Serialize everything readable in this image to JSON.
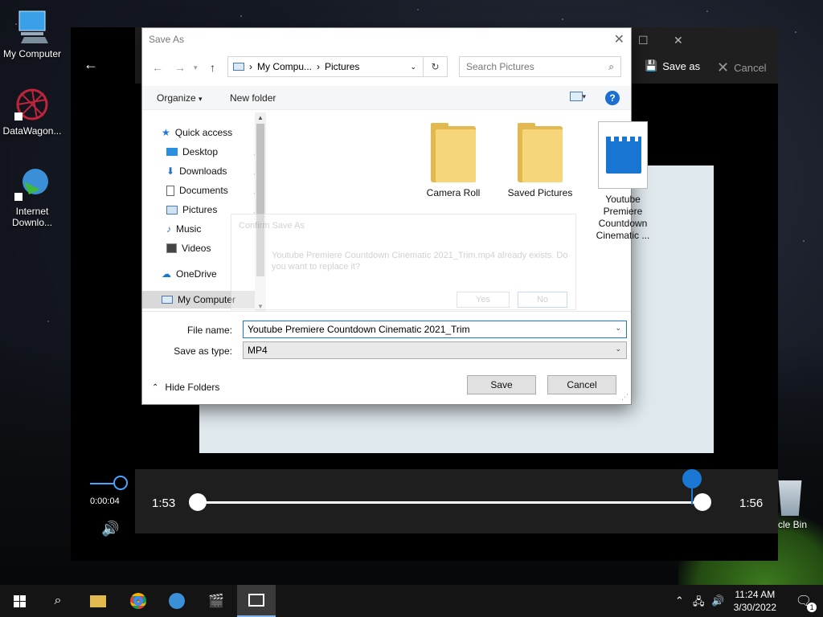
{
  "desktop": {
    "icons": [
      {
        "label": "My Computer"
      },
      {
        "label": "DataWagon..."
      },
      {
        "label": "Internet Downlo..."
      }
    ],
    "recycle_bin": "ycle Bin"
  },
  "photos_app": {
    "save_as_label": "Save as",
    "cancel_label": "Cancel",
    "start_time": "1:53",
    "end_time": "1:56",
    "current_time": "0:00:04"
  },
  "dialog": {
    "title": "Save As",
    "address": {
      "root": "My Compu...",
      "folder": "Pictures"
    },
    "search_placeholder": "Search Pictures",
    "toolbar": {
      "organize": "Organize",
      "new_folder": "New folder"
    },
    "nav": [
      {
        "label": "Quick access",
        "icon": "star-icon"
      },
      {
        "label": "Desktop",
        "icon": "desktop-icon",
        "pinned": true
      },
      {
        "label": "Downloads",
        "icon": "download-icon",
        "pinned": true
      },
      {
        "label": "Documents",
        "icon": "document-icon",
        "pinned": true
      },
      {
        "label": "Pictures",
        "icon": "pictures-icon",
        "pinned": true
      },
      {
        "label": "Music",
        "icon": "music-icon"
      },
      {
        "label": "Videos",
        "icon": "videos-icon"
      },
      {
        "label": "OneDrive",
        "icon": "cloud-icon"
      },
      {
        "label": "My Computer",
        "icon": "computer-icon",
        "selected": true
      }
    ],
    "files": [
      {
        "name": "Camera Roll",
        "type": "folder"
      },
      {
        "name": "Saved Pictures",
        "type": "folder"
      },
      {
        "name": "Youtube Premiere Countdown Cinematic ...",
        "type": "video"
      }
    ],
    "ghost_dialog": {
      "title": "Confirm Save As",
      "message": "Youtube Premiere Countdown Cinematic 2021_Trim.mp4 already exists. Do you want to replace it?",
      "yes": "Yes",
      "no": "No"
    },
    "file_name_label": "File name:",
    "file_name_value": "Youtube Premiere Countdown Cinematic 2021_Trim",
    "save_type_label": "Save as type:",
    "save_type_value": "MP4",
    "hide_folders": "Hide Folders",
    "save_button": "Save",
    "cancel_button": "Cancel"
  },
  "taskbar": {
    "time": "11:24 AM",
    "date": "3/30/2022",
    "notification_count": "1"
  }
}
